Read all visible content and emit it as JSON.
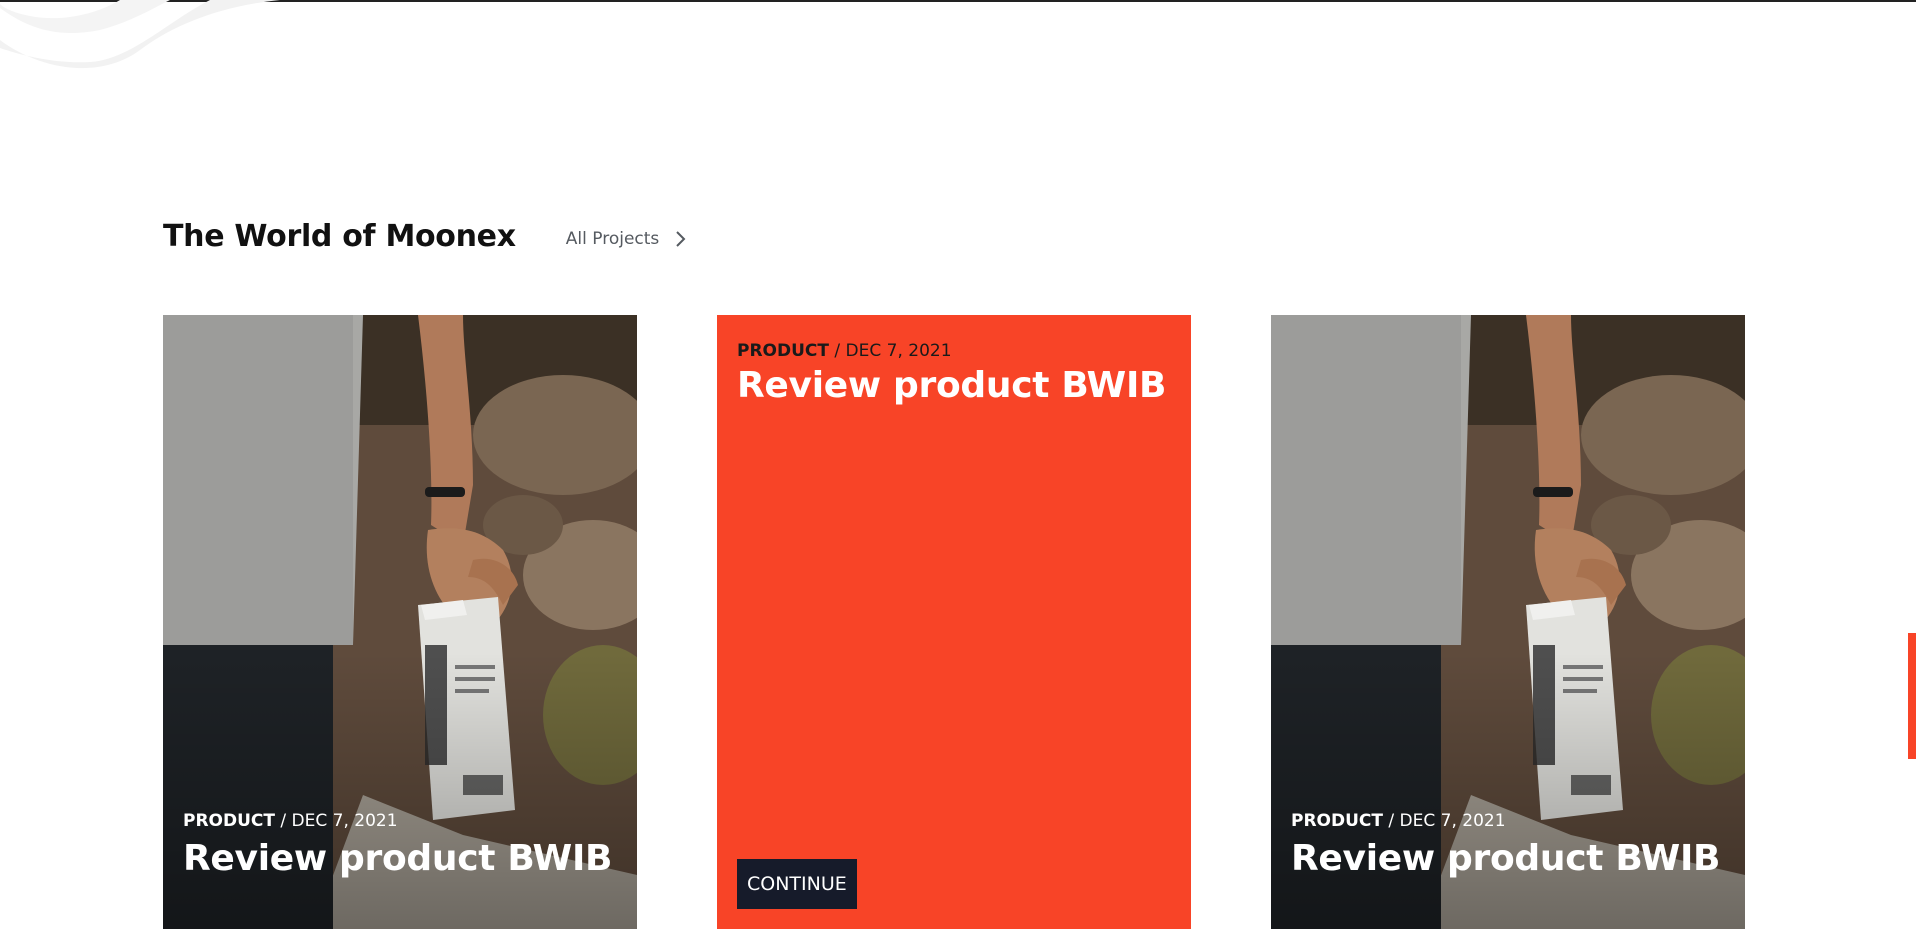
{
  "section": {
    "title": "The World of Moonex",
    "all_projects_label": "All Projects"
  },
  "cards": [
    {
      "category": "PRODUCT",
      "separator": " / ",
      "date": "DEC 7, 2021",
      "title": "Review product BWIB"
    },
    {
      "category": "PRODUCT",
      "separator": " / ",
      "date": "DEC 7, 2021",
      "title": "Review product BWIB",
      "button_label": "CONTINUE"
    },
    {
      "category": "PRODUCT",
      "separator": " / ",
      "date": "DEC 7, 2021",
      "title": "Review product BWIB"
    }
  ],
  "colors": {
    "accent": "#f84427",
    "button_bg": "#161b2a",
    "heading": "#111111",
    "link": "#555a60"
  },
  "icons": {
    "all_projects": "chevron-right-icon"
  }
}
